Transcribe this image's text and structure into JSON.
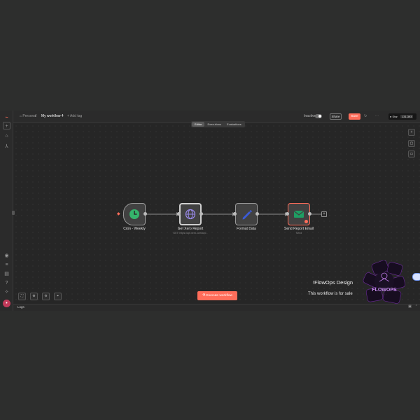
{
  "colors": {
    "accent": "#ff6d5a",
    "node_green": "#35b56c",
    "node_purple": "#7d6ae0",
    "node_blue": "#3b5bd8",
    "email_green": "#1e9e63"
  },
  "topbar": {
    "breadcrumb_root": "Personal",
    "workflow_name": "My workflow 4",
    "add_tag": "+ Add tag",
    "inactive_label": "Inactive",
    "share": "Share",
    "save": "Save",
    "star_label": "Star",
    "star_count": "131,393"
  },
  "tabs": [
    "Editor",
    "Executions",
    "Evaluations"
  ],
  "nodes": [
    {
      "label": "Cron - Weekly",
      "sub": "",
      "icon": "clock-icon"
    },
    {
      "label": "Get Xero Report",
      "sub": "GET: https://api.xero.com/api...",
      "icon": "globe-icon"
    },
    {
      "label": "Format Data",
      "sub": "",
      "icon": "pencil-icon"
    },
    {
      "label": "Send Report Email",
      "sub": "Send",
      "icon": "envelope-icon"
    }
  ],
  "execute_button": "Execute workflow",
  "logs_label": "Logs",
  "watermark": {
    "title": "!FlowOps Design",
    "subtitle": "This workflow is for sale",
    "logo_text": "FLOWOPS"
  }
}
